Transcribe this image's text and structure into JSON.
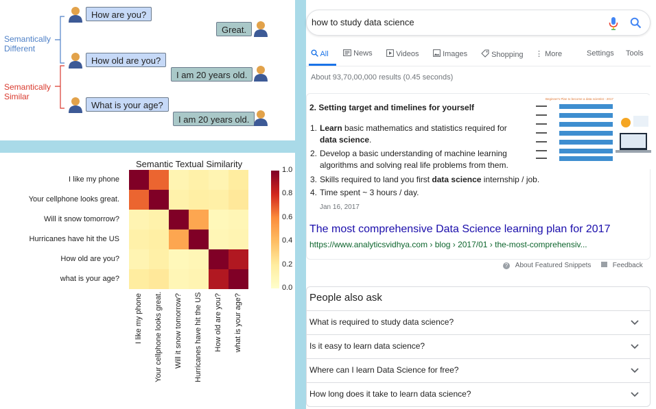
{
  "chat": {
    "group_different": {
      "line1": "Semantically",
      "line2": "Different",
      "color": "#4f81c7"
    },
    "group_similar": {
      "line1": "Semantically",
      "line2": "Similar",
      "color": "#d93a2e"
    },
    "messages": [
      {
        "text": "How are you?",
        "side": "left",
        "style": "blue"
      },
      {
        "text": "Great.",
        "side": "right",
        "style": "gray"
      },
      {
        "text": "How old are you?",
        "side": "left",
        "style": "blue"
      },
      {
        "text": "I am 20 years old.",
        "side": "right",
        "style": "gray"
      },
      {
        "text": "What is your age?",
        "side": "left",
        "style": "blue"
      },
      {
        "text": "I am 20 years old.",
        "side": "right",
        "style": "gray"
      }
    ]
  },
  "chart_data": {
    "type": "heatmap",
    "title": "Semantic Textual Similarity",
    "row_labels": [
      "I like my phone",
      "Your cellphone looks great.",
      "Will it snow tomorrow?",
      "Hurricanes have hit the US",
      "How old are you?",
      "what is your age?"
    ],
    "col_labels": [
      "I like my phone",
      "Your cellphone looks great.",
      "Will it snow tomorrow?",
      "Hurricanes have hit the US",
      "How old are you?",
      "what is your age?"
    ],
    "values": [
      [
        1.0,
        0.68,
        0.12,
        0.16,
        0.12,
        0.2
      ],
      [
        0.68,
        1.0,
        0.15,
        0.18,
        0.17,
        0.22
      ],
      [
        0.12,
        0.15,
        1.0,
        0.5,
        0.08,
        0.1
      ],
      [
        0.16,
        0.18,
        0.5,
        1.0,
        0.1,
        0.12
      ],
      [
        0.12,
        0.17,
        0.08,
        0.1,
        1.0,
        0.88
      ],
      [
        0.2,
        0.22,
        0.1,
        0.12,
        0.88,
        1.0
      ]
    ],
    "colorbar": {
      "min": 0.0,
      "max": 1.0,
      "ticks": [
        "0.0",
        "0.2",
        "0.4",
        "0.6",
        "0.8",
        "1.0"
      ]
    },
    "colormap": "YlOrRd"
  },
  "search": {
    "query": "how to study data science",
    "tabs": [
      {
        "label": "All",
        "icon": "search-icon",
        "active": true
      },
      {
        "label": "News",
        "icon": "news-icon",
        "active": false
      },
      {
        "label": "Videos",
        "icon": "video-icon",
        "active": false
      },
      {
        "label": "Images",
        "icon": "image-icon",
        "active": false
      },
      {
        "label": "Shopping",
        "icon": "tag-icon",
        "active": false
      },
      {
        "label": "More",
        "icon": "more-icon",
        "active": false
      }
    ],
    "settings_label": "Settings",
    "tools_label": "Tools",
    "stats": "About 93,70,00,000 results (0.45 seconds)",
    "snippet": {
      "heading": "2. Setting target and timelines for yourself",
      "items": [
        {
          "num": "1.",
          "pre": "Learn",
          "pre_bold": true,
          "text": " basic mathematics and statistics required for",
          "line2_bold": "data science",
          "line2_rest": "."
        },
        {
          "num": "2.",
          "line1": "Develop a basic understanding of machine learning",
          "line2": "algorithms and solving real life problems from them."
        },
        {
          "num": "3.",
          "a": "Skills required to land you first ",
          "b": "data science",
          "c": " internship / job."
        },
        {
          "num": "4.",
          "line1": "Time spent ~ 3 hours / day."
        }
      ],
      "date": "Jan 16, 2017",
      "thumb_title": "Beginner's Plan to become a data scientist - 2017"
    },
    "result_title": "The most comprehensive Data Science learning plan for 2017",
    "result_url": "https://www.analyticsvidhya.com › blog › 2017/01 › the-most-comprehensiv...",
    "about_snippets": "About Featured Snippets",
    "feedback": "Feedback",
    "people_also_ask": {
      "title": "People also ask",
      "questions": [
        "What is required to study data science?",
        "Is it easy to learn data science?",
        "Where can I learn Data Science for free?",
        "How long does it take to learn data science?"
      ]
    },
    "colors": {
      "accent": "#1a73e8",
      "link": "#1a0dab",
      "url": "#0d652d"
    }
  }
}
